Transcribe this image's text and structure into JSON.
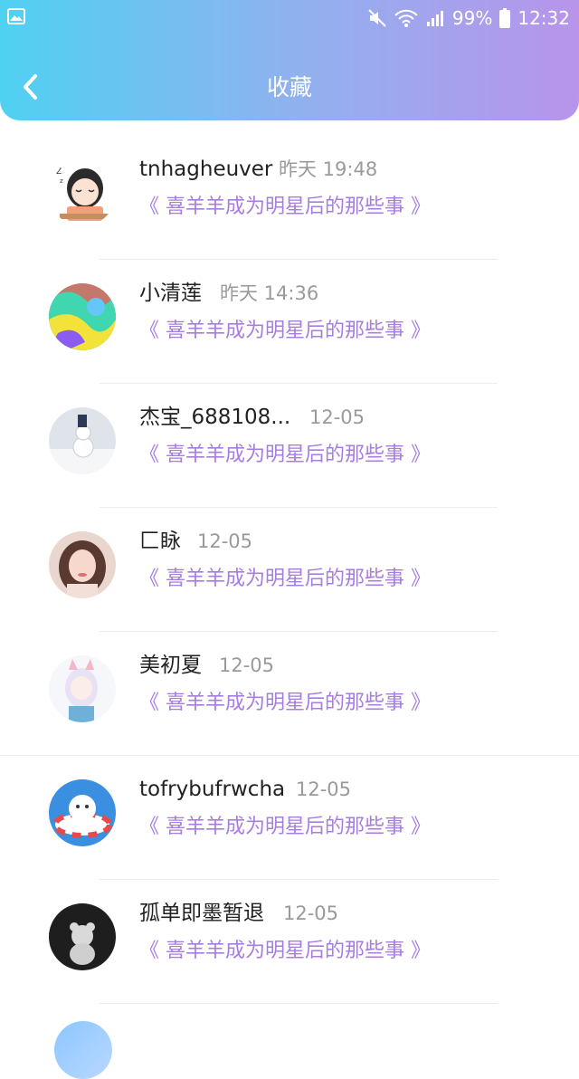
{
  "status_bar": {
    "battery": "99%",
    "time": "12:32"
  },
  "header": {
    "title": "收藏"
  },
  "items": [
    {
      "name": "tnhagheuver",
      "time": "昨天 19:48",
      "link": "《 喜羊羊成为明星后的那些事 》"
    },
    {
      "name": "小清莲",
      "time": "昨天 14:36",
      "link": "《 喜羊羊成为明星后的那些事 》"
    },
    {
      "name": "杰宝_688108...",
      "time": "12-05",
      "link": "《 喜羊羊成为明星后的那些事 》"
    },
    {
      "name": "匚眿",
      "time": "12-05",
      "link": "《 喜羊羊成为明星后的那些事 》"
    },
    {
      "name": "美初夏",
      "time": "12-05",
      "link": "《 喜羊羊成为明星后的那些事 》"
    },
    {
      "name": "tofrybufrwcha",
      "time": "12-05",
      "link": "《 喜羊羊成为明星后的那些事 》"
    },
    {
      "name": "孤单即墨暂退",
      "time": "12-05",
      "link": "《 喜羊羊成为明星后的那些事 》"
    }
  ]
}
